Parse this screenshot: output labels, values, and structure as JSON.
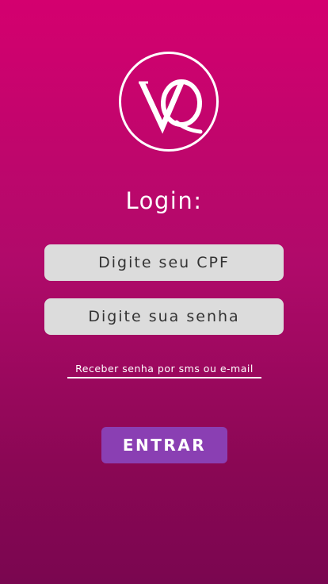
{
  "logo": {
    "text": "VQ"
  },
  "login": {
    "title": "Login:",
    "cpf_placeholder": "Digite seu CPF",
    "password_placeholder": "Digite sua senha",
    "sms_link": "Receber senha por sms ou e-mail",
    "enter_label": "ENTRAR"
  },
  "colors": {
    "background_top": "#d4006f",
    "background_bottom": "#7a0650",
    "field_background": "#dcdcdc",
    "button": "#8a3fb3",
    "text_light": "#ffffff"
  }
}
